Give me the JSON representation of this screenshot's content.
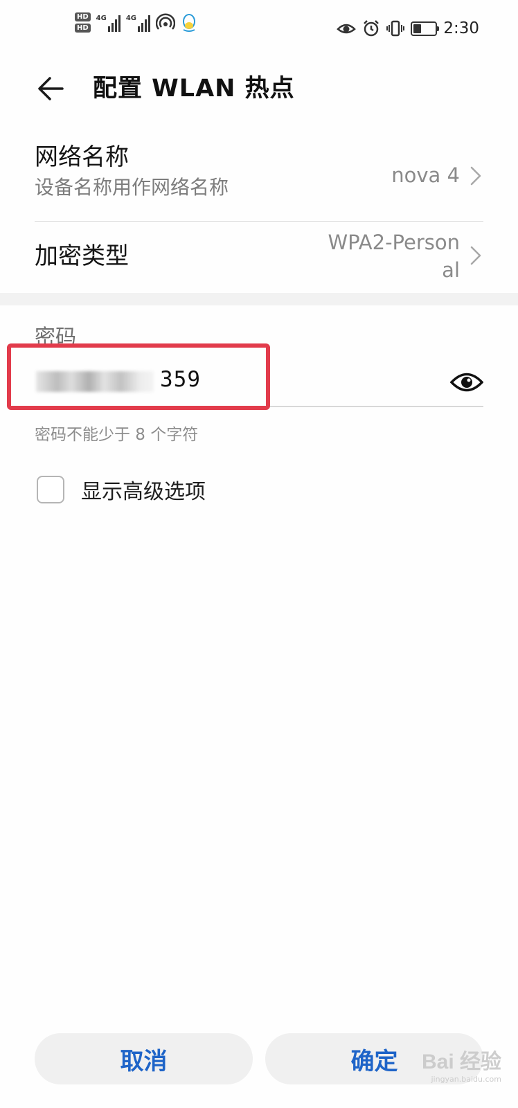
{
  "status_bar": {
    "sim1": "HD",
    "sim2": "HD",
    "net1": "4G",
    "net2": "4G",
    "time": "2:30",
    "icons": [
      "hd-icon",
      "signal-icon",
      "hotspot-icon",
      "qq-icon",
      "eye-comfort-icon",
      "alarm-icon",
      "vibrate-icon",
      "battery-icon"
    ]
  },
  "header": {
    "back_icon": "arrow-left-icon",
    "title": "配置 WLAN 热点"
  },
  "network_name": {
    "title": "网络名称",
    "subtitle": "设备名称用作网络名称",
    "value": "nova 4",
    "chevron_icon": "chevron-right-icon"
  },
  "encryption": {
    "title": "加密类型",
    "value_line1": "WPA2-Person",
    "value_line2": "al",
    "chevron_icon": "chevron-right-icon"
  },
  "password": {
    "label": "密码",
    "visible_suffix": "359",
    "hint": "密码不能少于 8 个字符",
    "toggle_icon": "eye-icon",
    "highlight_color": "#e23b4b"
  },
  "advanced": {
    "label": "显示高级选项",
    "checked": false
  },
  "buttons": {
    "cancel": "取消",
    "confirm": "确定"
  },
  "watermark": {
    "main": "Bai 经验",
    "sub": "jingyan.baidu.com"
  },
  "colors": {
    "accent": "#1e64c8",
    "background": "#fefefe"
  }
}
